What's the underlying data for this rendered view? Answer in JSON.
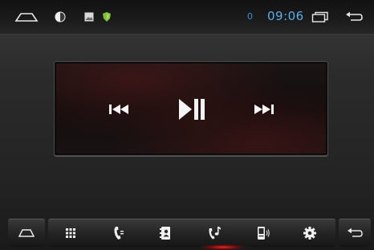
{
  "status_bar": {
    "signal_indicator": "0",
    "time": "09:06",
    "icons": [
      "home-icon",
      "brightness-icon",
      "gallery-icon",
      "shield-icon",
      "recents-icon",
      "back-icon"
    ]
  },
  "player": {
    "controls": [
      "previous-track-icon",
      "play-pause-icon",
      "next-track-icon"
    ]
  },
  "dock": {
    "items": [
      "home-icon",
      "apps-grid-icon",
      "phone-icon",
      "contacts-icon",
      "music-icon",
      "phone-settings-icon",
      "settings-icon",
      "back-icon"
    ]
  },
  "colors": {
    "status_text": "#5aaee8",
    "icon_white": "#f2f2f2",
    "indicator_glow": "#ff2828"
  }
}
